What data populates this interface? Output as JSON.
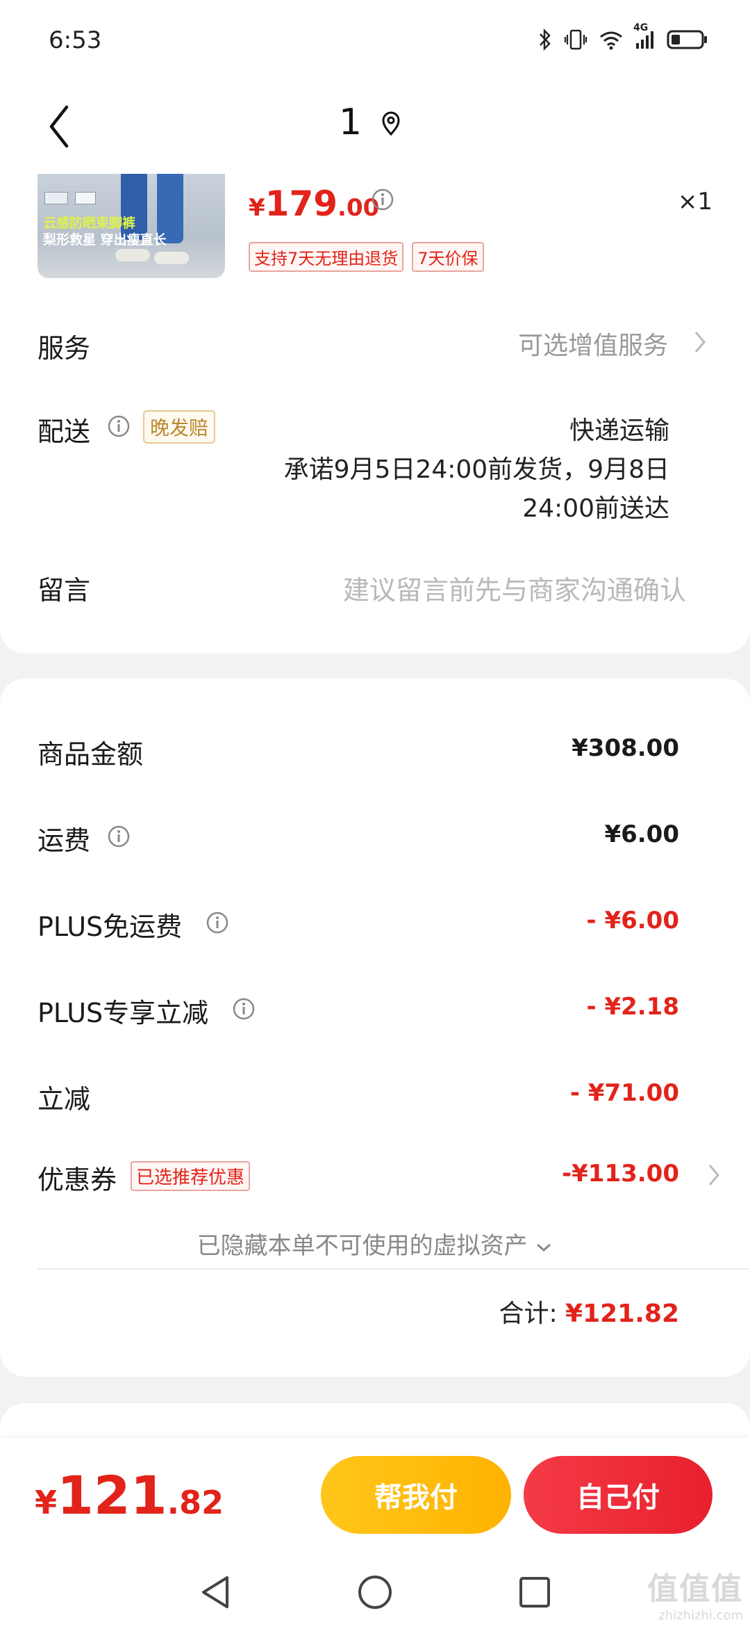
{
  "status_bar": {
    "time": "6:53",
    "network": "4G",
    "icons": [
      "bluetooth-icon",
      "vibrate-icon",
      "wifi-icon",
      "signal-icon",
      "battery-icon"
    ]
  },
  "header": {
    "title": "1",
    "back_icon": "chevron-left-icon",
    "location_icon": "location-pin-icon"
  },
  "product": {
    "image_text_line1": "云感防晒束脚裤",
    "image_text_line2": "梨形救星 穿出瘦直长",
    "price_currency": "¥",
    "price_integer": "179",
    "price_decimal": ".00",
    "quantity": "×1",
    "tags": [
      "支持7天无理由退货",
      "7天价保"
    ]
  },
  "service": {
    "label": "服务",
    "value": "可选增值服务"
  },
  "delivery": {
    "label": "配送",
    "late_tag": "晚发赔",
    "method": "快递运输",
    "promise_line1": "承诺9月5日24:00前发货，9月8日",
    "promise_line2": "24:00前送达"
  },
  "message": {
    "label": "留言",
    "placeholder": "建议留言前先与商家沟通确认"
  },
  "summary": {
    "goods_amount": {
      "label": "商品金额",
      "value": "¥308.00"
    },
    "shipping": {
      "label": "运费",
      "value": "¥6.00"
    },
    "plus_free_shipping": {
      "label": "PLUS免运费",
      "value": "- ¥6.00"
    },
    "plus_discount": {
      "label": "PLUS专享立减",
      "value": "- ¥2.18"
    },
    "instant_discount": {
      "label": "立减",
      "value": "- ¥71.00"
    },
    "coupon": {
      "label": "优惠券",
      "tag": "已选推荐优惠",
      "value": "-¥113.00"
    },
    "hidden_assets": "已隐藏本单不可使用的虚拟资产",
    "total_label": "合计:",
    "total_value": "¥121.82"
  },
  "bottom_bar": {
    "price_currency": "¥",
    "price_integer": "121",
    "price_decimal": ".82",
    "help_pay_label": "帮我付",
    "self_pay_label": "自己付"
  },
  "watermark": {
    "logo": "值值值",
    "url": "zhizhizhi.com"
  },
  "colors": {
    "accent_red": "#e2231a",
    "help_pay_yellow": "#ffbd0d",
    "self_pay_red": "#ee2c3a"
  }
}
